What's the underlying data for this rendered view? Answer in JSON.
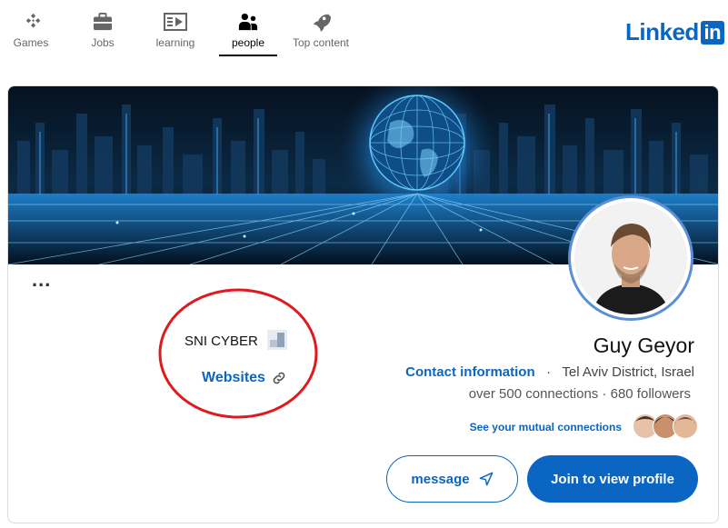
{
  "nav": {
    "items": [
      {
        "label": "Games",
        "icon": "puzzle-icon"
      },
      {
        "label": "Jobs",
        "icon": "briefcase-icon"
      },
      {
        "label": "learning",
        "icon": "video-icon"
      },
      {
        "label": "people",
        "icon": "people-icon",
        "active": true
      },
      {
        "label": "Top content",
        "icon": "rocket-icon"
      }
    ],
    "logo_text": "Linked",
    "logo_badge": "in"
  },
  "profile": {
    "more_label": "...",
    "company": "SNI CYBER",
    "websites_label": "Websites",
    "name": "Guy Geyor",
    "contact_label": "Contact information",
    "separator": "·",
    "location": "Tel Aviv District, Israel",
    "connections": "over 500 connections · 680 followers",
    "mutual_label": "See your mutual connections"
  },
  "actions": {
    "message_label": "message",
    "join_label": "Join to view profile"
  },
  "colors": {
    "brand": "#0a66c2",
    "annotation": "#e0191f"
  }
}
